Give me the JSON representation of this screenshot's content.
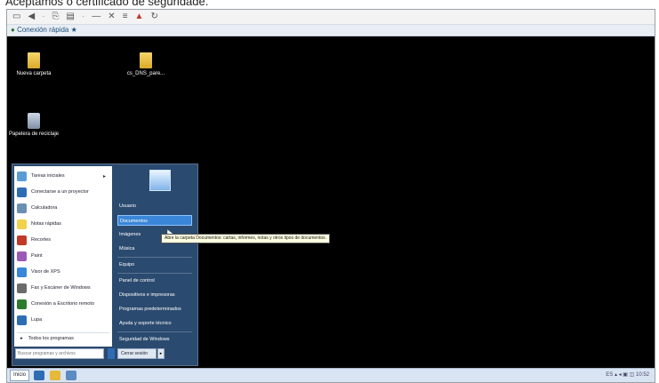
{
  "caption": "Aceptamos o certificado de seguridade.",
  "toolbar": {
    "icons": [
      "monitor-icon",
      "back-icon",
      "copy-icon",
      "paste-icon",
      "minimize-icon",
      "close-icon",
      "bars-icon",
      "pin-icon",
      "refresh-icon"
    ]
  },
  "connection": {
    "label": "Conexión rápida"
  },
  "desktop": {
    "icons": [
      {
        "label": "Nueva carpeta"
      },
      {
        "label": "cs_DNS_pare..."
      },
      {
        "label": "Papelera de reciclaje"
      }
    ]
  },
  "start_menu": {
    "programs": [
      {
        "label": "Tareas iniciales",
        "has_arrow": true,
        "color": "#5b9bd5"
      },
      {
        "label": "Conectarse a un proyector",
        "has_arrow": false,
        "color": "#2e6db4"
      },
      {
        "label": "Calculadora",
        "has_arrow": false,
        "color": "#6a8fb3"
      },
      {
        "label": "Notas rápidas",
        "has_arrow": false,
        "color": "#f2d24c"
      },
      {
        "label": "Recortes",
        "has_arrow": false,
        "color": "#c0392b"
      },
      {
        "label": "Paint",
        "has_arrow": false,
        "color": "#9b59b6"
      },
      {
        "label": "Visor de XPS",
        "has_arrow": false,
        "color": "#3a86d8"
      },
      {
        "label": "Fax y Escáner de Windows",
        "has_arrow": false,
        "color": "#6b6b6b"
      },
      {
        "label": "Conexión a Escritorio remoto",
        "has_arrow": false,
        "color": "#2d7b2d"
      },
      {
        "label": "Lupa",
        "has_arrow": false,
        "color": "#2e6db4"
      }
    ],
    "all_programs": "Todos los programas",
    "search_placeholder": "Buscar programas y archivos",
    "right_items": [
      {
        "label": "Usuario",
        "highlighted": false
      },
      {
        "label": "Documentos",
        "highlighted": true
      },
      {
        "label": "Imágenes",
        "highlighted": false
      },
      {
        "label": "Música",
        "highlighted": false
      },
      {
        "label": "Equipo",
        "highlighted": false
      },
      {
        "label": "Panel de control",
        "highlighted": false
      },
      {
        "label": "Dispositivos e impresoras",
        "highlighted": false
      },
      {
        "label": "Programas predeterminados",
        "highlighted": false
      },
      {
        "label": "Ayuda y soporte técnico",
        "highlighted": false
      },
      {
        "label": "Seguridad de Windows",
        "highlighted": false
      }
    ],
    "shutdown_label": "Cerrar sesión",
    "shutdown_arrow": "▸"
  },
  "tooltip": "Abre la carpeta Documentos: cartas, informes, notas y otros tipos de documentos.",
  "taskbar": {
    "start_label": "Inicio",
    "tray_text": "ES ▴ ◂ ▣ ◫ 10:52"
  }
}
